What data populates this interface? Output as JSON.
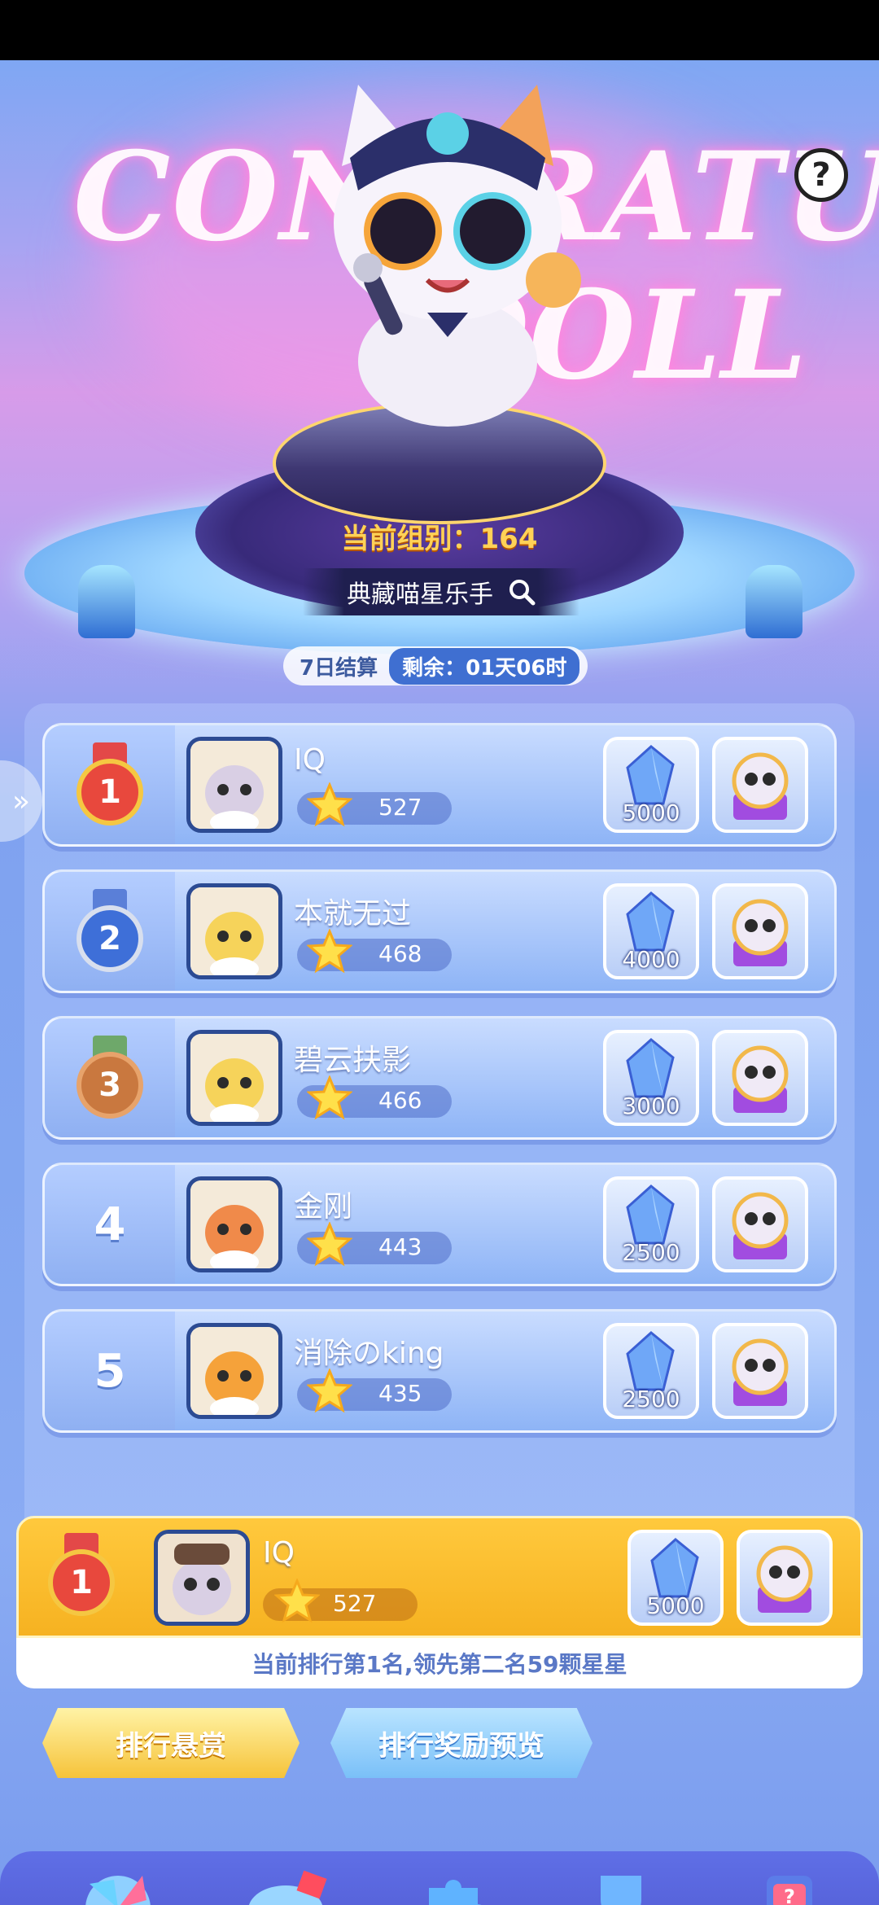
{
  "banner": {
    "line1": "CONGRATULATION",
    "line2": "DOLL"
  },
  "help": {
    "label": "?"
  },
  "group": {
    "label": "当前组别：164"
  },
  "title": {
    "label": "典藏喵星乐手"
  },
  "timer": {
    "cycle": "7日结算",
    "remaining": "剩余：01天06时"
  },
  "ranking": [
    {
      "rank": "1",
      "name": "IQ",
      "score": "527",
      "reward_amount": "5000",
      "medal": "gold"
    },
    {
      "rank": "2",
      "name": "本就无过",
      "score": "468",
      "reward_amount": "4000",
      "medal": "silver"
    },
    {
      "rank": "3",
      "name": "碧云扶影",
      "score": "466",
      "reward_amount": "3000",
      "medal": "bronze"
    },
    {
      "rank": "4",
      "name": "金刚",
      "score": "443",
      "reward_amount": "2500",
      "medal": "none"
    },
    {
      "rank": "5",
      "name": "消除のking",
      "score": "435",
      "reward_amount": "2500",
      "medal": "none"
    }
  ],
  "me": {
    "rank": "1",
    "name": "IQ",
    "score": "527",
    "reward_amount": "5000",
    "note": "当前排行第1名,领先第二名59颗星星"
  },
  "buttons": {
    "rank_reward": "排行悬赏",
    "reward_preview": "排行奖励预览"
  },
  "colors": {
    "gold": "#f1b62b",
    "silver": "#5a7fd8",
    "bronze": "#c9783f",
    "accent": "#3f6fd1"
  },
  "nav": [
    "pinwheel-icon",
    "whistle-icon",
    "puzzle-icon",
    "trophy-icon",
    "gift-machine-icon"
  ]
}
